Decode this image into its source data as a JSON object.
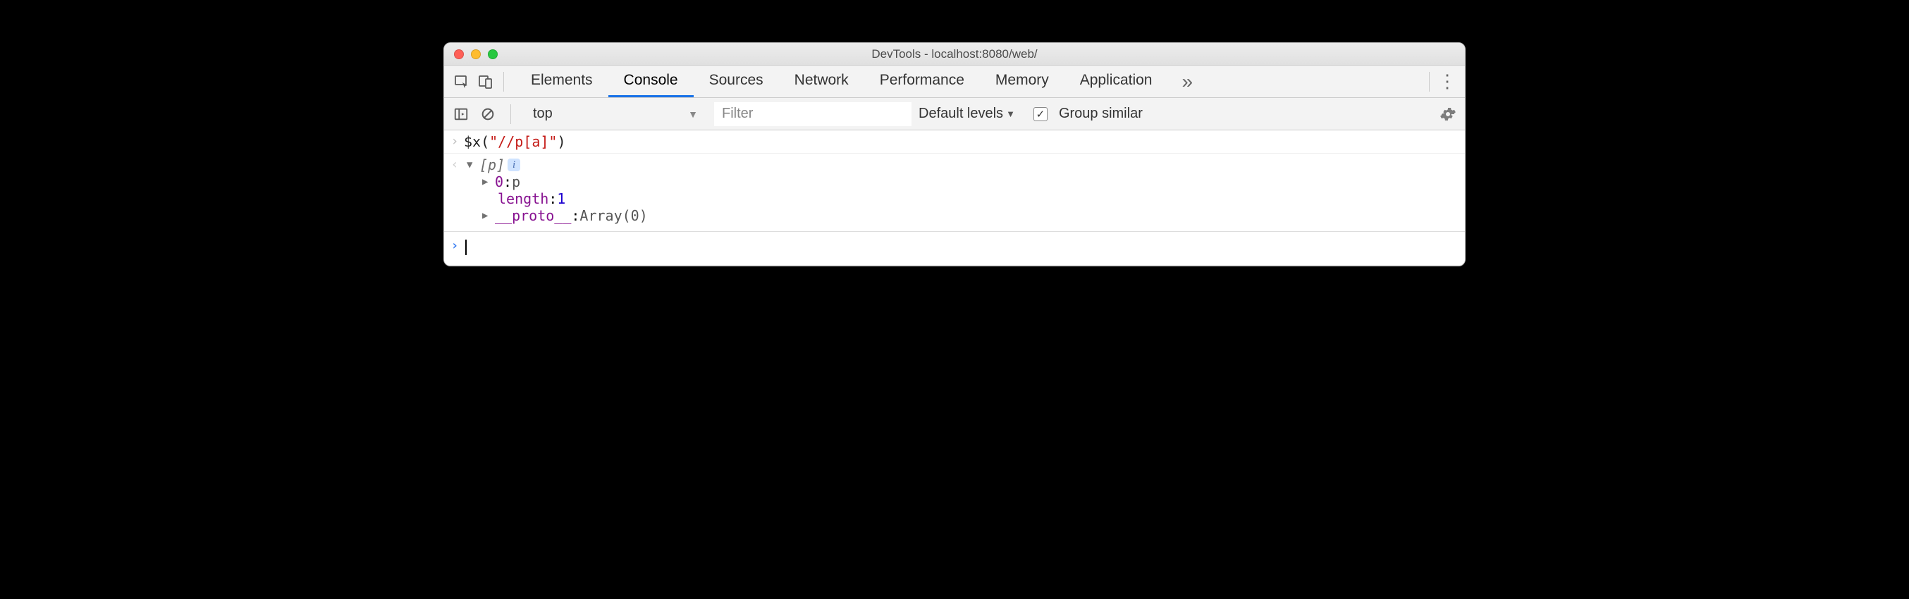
{
  "window": {
    "title": "DevTools - localhost:8080/web/"
  },
  "tabs": {
    "items": [
      "Elements",
      "Console",
      "Sources",
      "Network",
      "Performance",
      "Memory",
      "Application"
    ],
    "active_index": 1
  },
  "toolbar": {
    "context": "top",
    "filter_placeholder": "Filter",
    "levels_label": "Default levels",
    "group_similar_label": "Group similar",
    "group_similar_checked": true
  },
  "console": {
    "input": {
      "fn": "$x",
      "open": "(",
      "arg": "\"//p[a]\"",
      "close": ")"
    },
    "result": {
      "summary_open": "[",
      "summary_item": "p",
      "summary_close": "]",
      "rows": [
        {
          "caret": true,
          "key": "0",
          "sep": ": ",
          "val": "p",
          "val_class": "c-proto"
        },
        {
          "caret": false,
          "key": "length",
          "sep": ": ",
          "val": "1",
          "val_class": "c-num"
        },
        {
          "caret": true,
          "key": "__proto__",
          "sep": ": ",
          "val": "Array(0)",
          "val_class": "c-proto"
        }
      ]
    }
  }
}
